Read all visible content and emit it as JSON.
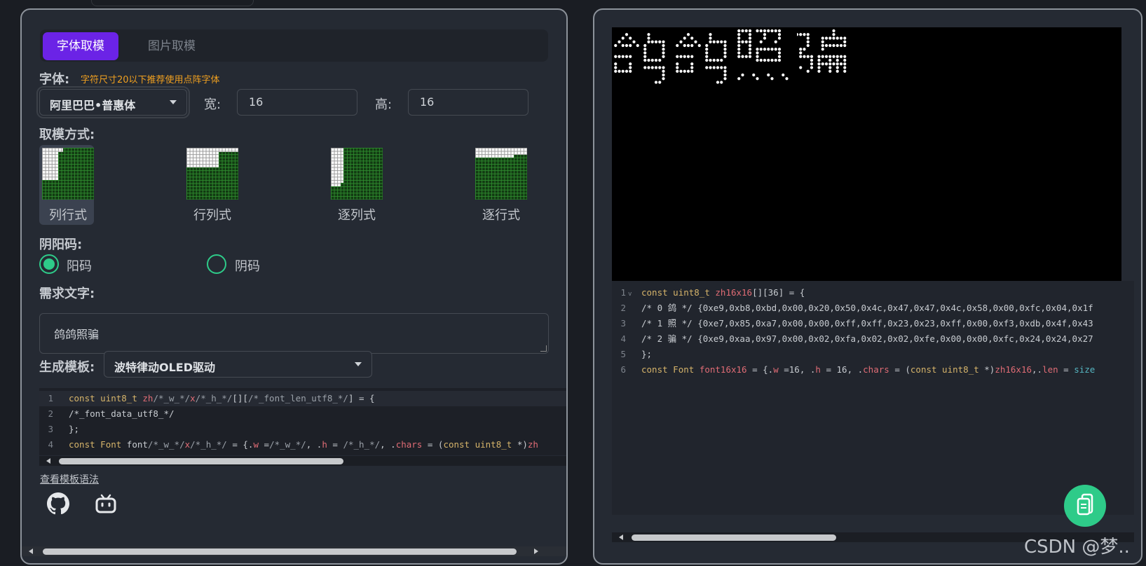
{
  "left": {
    "tabs": [
      {
        "label": "字体取模"
      },
      {
        "label": "图片取模"
      }
    ],
    "font_label": "字体:",
    "font_hint": "字符尺寸20以下推荐使用点阵字体",
    "font_select": "阿里巴巴•普惠体",
    "width_label": "宽:",
    "width_value": "16",
    "height_label": "高:",
    "height_value": "16",
    "mode_label": "取模方式:",
    "modes": [
      {
        "label": "列行式",
        "selected": true
      },
      {
        "label": "行列式"
      },
      {
        "label": "逐列式"
      },
      {
        "label": "逐行式"
      }
    ],
    "polarity_label": "阴阳码:",
    "polarity": [
      {
        "label": "阳码",
        "checked": true
      },
      {
        "label": "阴码",
        "checked": false
      }
    ],
    "text_label": "需求文字:",
    "text_value": "鸽鸽照骗",
    "template_label": "生成模板:",
    "template_select": "波特律动OLED驱动",
    "template_code": [
      {
        "n": "1",
        "text": "const uint8_t zh/*_w_*/x/*_h_*/[][/*_font_len_utf8_*/] = {"
      },
      {
        "n": "2",
        "text": "/*_font_data_utf8_*/"
      },
      {
        "n": "3",
        "text": "};"
      },
      {
        "n": "4",
        "text": "const Font font/*_w_*/x/*_h_*/ = {.w =/*_w_*/, .h = /*_h_*/, .chars = (const uint8_t *)zh"
      }
    ],
    "syntax_link": "查看模板语法",
    "social_icons": [
      "github-icon",
      "bilibili-icon"
    ]
  },
  "right": {
    "preview_text": "鸽鸽照骗",
    "output_code": [
      {
        "n": "1",
        "text": "const uint8_t zh16x16[][36] = {"
      },
      {
        "n": "2",
        "text": "/* 0 鸽 */ {0xe9,0xb8,0xbd,0x00,0x20,0x50,0x4c,0x47,0x47,0x4c,0x58,0x00,0xfc,0x04,0x1f"
      },
      {
        "n": "3",
        "text": "/* 1 照 */ {0xe7,0x85,0xa7,0x00,0x00,0xff,0xff,0x23,0x23,0xff,0x00,0xf3,0xdb,0x4f,0x43"
      },
      {
        "n": "4",
        "text": "/* 2 骗 */ {0xe9,0xaa,0x97,0x00,0x02,0xfa,0x02,0x02,0xfe,0x00,0x00,0xfc,0x24,0x24,0x27"
      },
      {
        "n": "5",
        "text": "};"
      },
      {
        "n": "6",
        "text": "const Font font16x16 = {.w =16, .h = 16, .chars = (const uint8_t *)zh16x16,.len = size"
      }
    ],
    "copy_button_icon": "copy-icon"
  },
  "watermark": "CSDN @梦..",
  "colors": {
    "accent": "#6b23e6",
    "green": "#2ecb89",
    "warning": "#f0a020"
  }
}
